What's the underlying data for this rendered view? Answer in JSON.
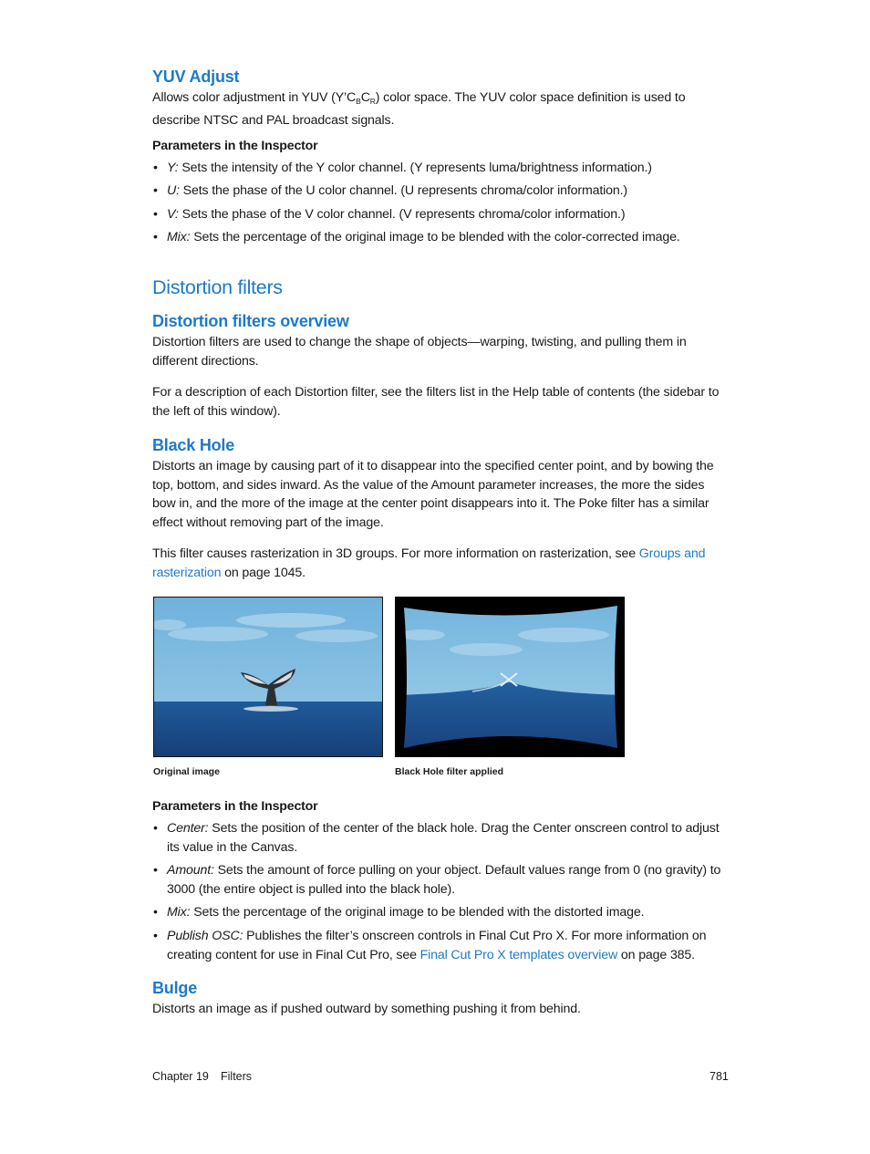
{
  "yuv": {
    "heading": "YUV Adjust",
    "desc_pre": "Allows color adjustment in YUV (Y’C",
    "sub_b": "B",
    "mid": "C",
    "sub_r": "R",
    "desc_post": ") color space. The YUV color space definition is used to describe NTSC and PAL broadcast signals.",
    "params_label": "Parameters in the Inspector",
    "params": [
      {
        "term": "Y:",
        "text": " Sets the intensity of the Y color channel. (Y represents luma/brightness information.)"
      },
      {
        "term": "U:",
        "text": " Sets the phase of the U color channel. (U represents chroma/color information.)"
      },
      {
        "term": "V:",
        "text": " Sets the phase of the V color channel. (V represents chroma/color information.)"
      },
      {
        "term": "Mix:",
        "text": " Sets the percentage of the original image to be blended with the color-corrected image."
      }
    ]
  },
  "distortion": {
    "title": "Distortion filters",
    "overview_heading": "Distortion filters overview",
    "overview_p1": "Distortion filters are used to change the shape of objects—warping, twisting, and pulling them in different directions.",
    "overview_p2": "For a description of each Distortion filter, see the filters list in the Help table of contents (the sidebar to the left of this window)."
  },
  "black_hole": {
    "heading": "Black Hole",
    "desc": "Distorts an image by causing part of it to disappear into the specified center point, and by bowing the top, bottom, and sides inward. As the value of the Amount parameter increases, the more the sides bow in, and the more of the image at the center point disappears into it. The Poke filter has a similar effect without removing part of the image.",
    "raster_pre": "This filter causes rasterization in 3D groups. For more information on rasterization, see ",
    "raster_link": "Groups and rasterization",
    "raster_post": " on page 1045.",
    "figures": [
      {
        "caption": "Original image",
        "subject": "whale tail above ocean"
      },
      {
        "caption": "Black Hole filter applied",
        "subject": "whale tail pulled into center point"
      }
    ],
    "params_label": "Parameters in the Inspector",
    "params": [
      {
        "term": "Center:",
        "text": " Sets the position of the center of the black hole. Drag the Center onscreen control to adjust its value in the Canvas."
      },
      {
        "term": "Amount:",
        "text": " Sets the amount of force pulling on your object. Default values range from 0 (no gravity) to 3000 (the entire object is pulled into the black hole)."
      },
      {
        "term": "Mix:",
        "text": " Sets the percentage of the original image to be blended with the distorted image."
      },
      {
        "term": "Publish OSC:",
        "text": " Publishes the filter’s onscreen controls in Final Cut Pro X. For more information on creating content for use in Final Cut Pro, see ",
        "link": "Final Cut Pro X templates overview",
        "post": " on page 385."
      }
    ]
  },
  "bulge": {
    "heading": "Bulge",
    "desc": "Distorts an image as if pushed outward by something pushing it from behind."
  },
  "footer": {
    "chapter": "Chapter 19",
    "section": "Filters",
    "page_number": "781"
  },
  "colors": {
    "accent": "#1e7ac8",
    "text": "#1a1a1a"
  }
}
